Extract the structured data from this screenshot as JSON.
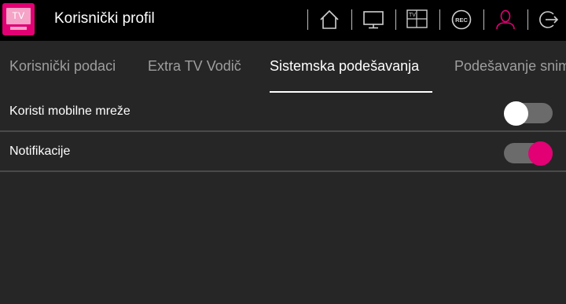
{
  "header": {
    "logo_text": "TV",
    "title": "Korisnički profil",
    "icons": [
      "home-icon",
      "tv-icon",
      "tv-guide-icon",
      "rec-icon",
      "user-icon",
      "logout-icon"
    ],
    "rec_label": "REC",
    "guide_label": "TV"
  },
  "tabs": [
    {
      "label": "Korisnički podaci",
      "active": false
    },
    {
      "label": "Extra TV Vodič",
      "active": false
    },
    {
      "label": "Sistemska podešavanja",
      "active": true
    },
    {
      "label": "Podešavanje snimanja",
      "active": false
    }
  ],
  "settings": [
    {
      "label": "Koristi mobilne mreže",
      "enabled": false
    },
    {
      "label": "Notifikacije",
      "enabled": true
    }
  ],
  "colors": {
    "accent": "#e20074",
    "background": "#262626",
    "topbar": "#000000",
    "toggle_off_thumb": "#ffffff",
    "toggle_track": "#6b6b6b"
  }
}
